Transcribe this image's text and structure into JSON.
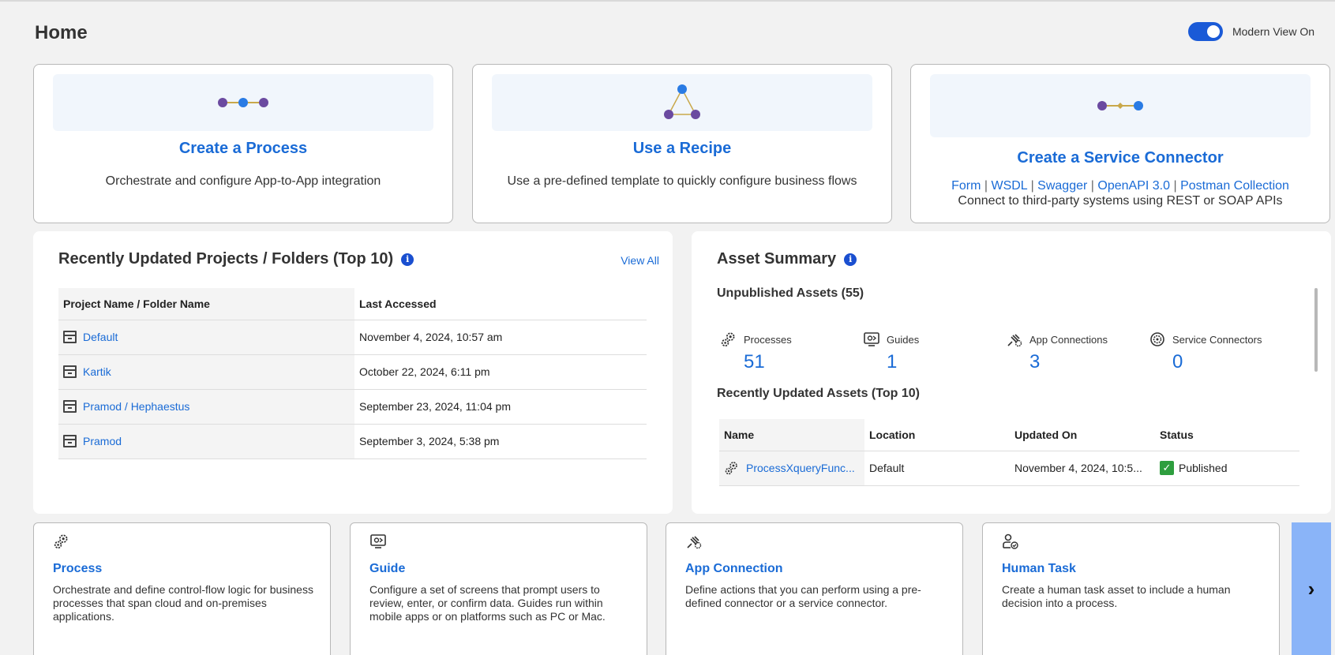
{
  "page": {
    "title": "Home"
  },
  "modern_view": {
    "label": "Modern View On",
    "on": true
  },
  "tiles": [
    {
      "title": "Create a Process",
      "description": "Orchestrate and configure App-to-App integration",
      "icon": "process-flow-icon"
    },
    {
      "title": "Use a Recipe",
      "description": "Use a pre-defined template to quickly configure business flows",
      "icon": "recipe-triangle-icon"
    },
    {
      "title": "Create a Service Connector",
      "description": "Connect to third-party systems using REST or SOAP APIs",
      "icon": "service-connector-icon",
      "links": [
        "Form",
        "WSDL",
        "Swagger",
        "OpenAPI 3.0",
        "Postman Collection"
      ],
      "separator": "|"
    }
  ],
  "projects": {
    "title": "Recently Updated Projects / Folders (Top 10)",
    "view_all": "View All",
    "columns": [
      "Project Name / Folder Name",
      "Last Accessed"
    ],
    "rows": [
      {
        "name": "Default",
        "accessed": "November 4, 2024, 10:57 am"
      },
      {
        "name": "Kartik",
        "accessed": "October 22, 2024, 6:11 pm"
      },
      {
        "name": "Pramod / Hephaestus",
        "accessed": "September 23, 2024, 11:04 pm"
      },
      {
        "name": "Pramod",
        "accessed": "September 3, 2024, 5:38 pm"
      }
    ]
  },
  "assets": {
    "title": "Asset Summary",
    "unpublished": "Unpublished Assets (55)",
    "stats": [
      {
        "label": "Processes",
        "value": "51",
        "icon": "gears-icon"
      },
      {
        "label": "Guides",
        "value": "1",
        "icon": "guide-screen-icon"
      },
      {
        "label": "App Connections",
        "value": "3",
        "icon": "app-connection-icon"
      },
      {
        "label": "Service Connectors",
        "value": "0",
        "icon": "service-gear-icon"
      }
    ],
    "recent_title": "Recently Updated Assets (Top 10)",
    "columns": [
      "Name",
      "Location",
      "Updated On",
      "Status"
    ],
    "rows": [
      {
        "name": "ProcessXqueryFunc...",
        "location": "Default",
        "updated": "November 4, 2024, 10:5...",
        "status": "Published"
      }
    ]
  },
  "cards": [
    {
      "title": "Process",
      "description": "Orchestrate and define control-flow logic for business processes that span cloud and on-premises applications.",
      "icon": "gears-icon"
    },
    {
      "title": "Guide",
      "description": "Configure a set of screens that prompt users to review, enter, or confirm data. Guides run within mobile apps or on platforms such as PC or Mac.",
      "icon": "guide-screen-icon"
    },
    {
      "title": "App Connection",
      "description": "Define actions that you can perform using a pre-defined connector or a service connector.",
      "icon": "app-connection-icon"
    },
    {
      "title": "Human Task",
      "description": "Create a human task asset to include a human decision into a process.",
      "icon": "human-task-icon"
    }
  ],
  "next_glyph": "›",
  "colors": {
    "accent": "#1a6bd6",
    "purple": "#6b4aa0",
    "blue_dot": "#2a7be4",
    "success": "#2e9e3e"
  }
}
